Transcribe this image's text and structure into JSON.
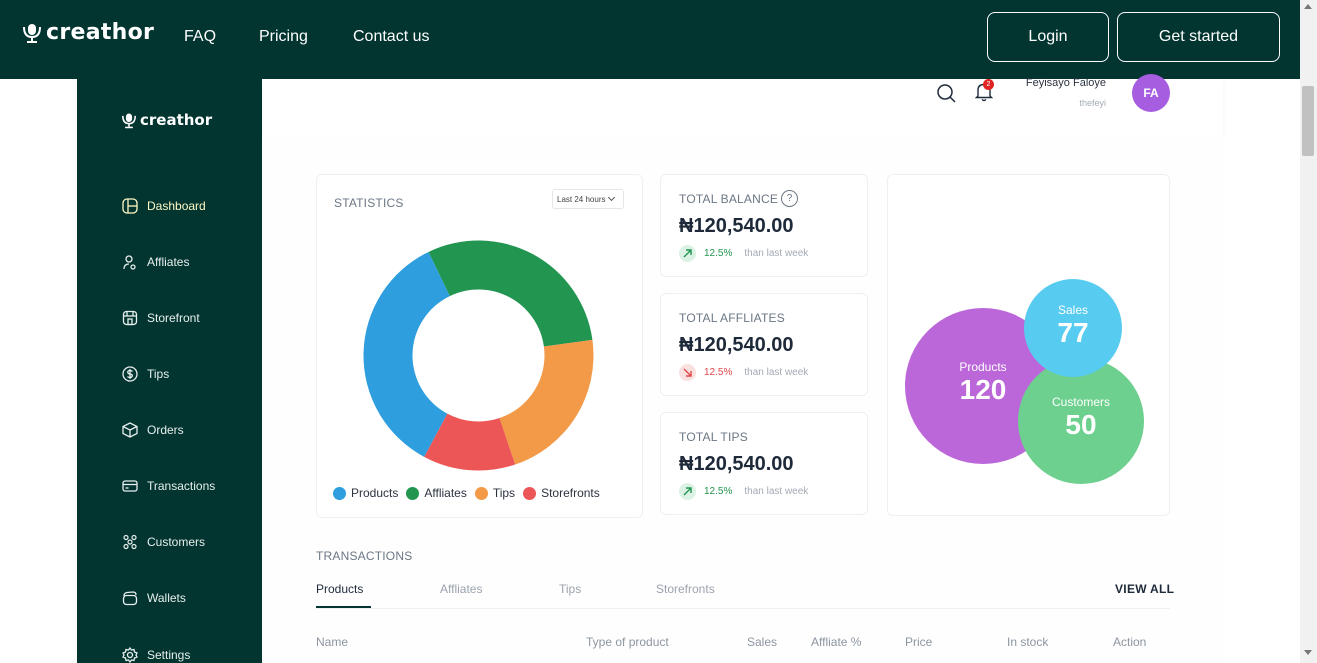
{
  "topnav": {
    "brand": "creathor",
    "links": [
      "FAQ",
      "Pricing",
      "Contact us"
    ],
    "login_label": "Login",
    "get_started_label": "Get started"
  },
  "sidebar": {
    "brand": "creathor",
    "items": [
      {
        "label": "Dashboard",
        "icon": "dashboard-icon",
        "active": true
      },
      {
        "label": "Affliates",
        "icon": "affiliate-user-icon"
      },
      {
        "label": "Storefront",
        "icon": "storefront-icon"
      },
      {
        "label": "Tips",
        "icon": "dollar-coin-icon"
      },
      {
        "label": "Orders",
        "icon": "box-icon"
      },
      {
        "label": "Transactions",
        "icon": "credit-card-icon"
      },
      {
        "label": "Customers",
        "icon": "people-group-icon"
      },
      {
        "label": "Wallets",
        "icon": "wallet-icon"
      },
      {
        "label": "Settings",
        "icon": "gear-icon"
      }
    ]
  },
  "header": {
    "user_name": "Feyisayo Faloye",
    "user_handle": "thefeyi",
    "avatar_initials": "FA",
    "avatar_color": "#a65de0",
    "notification_count": "2"
  },
  "statistics": {
    "title": "STATISTICS",
    "range": "Last 24 hours"
  },
  "chart_data": {
    "type": "pie",
    "donut": true,
    "categories": [
      "Products",
      "Affliates",
      "Tips",
      "Storefronts"
    ],
    "values": [
      35,
      30,
      22,
      13
    ],
    "colors": [
      "#2e9ede",
      "#229551",
      "#f29a48",
      "#ec5656"
    ],
    "legend_placement": "bottom"
  },
  "kpis": [
    {
      "title": "TOTAL BALANCE",
      "value": "₦120,540.00",
      "pct": "12.5%",
      "compare": "than last week",
      "direction": "up",
      "has_help": true
    },
    {
      "title": "TOTAL AFFLIATES",
      "value": "₦120,540.00",
      "pct": "12.5%",
      "compare": "than last week",
      "direction": "down",
      "has_help": false
    },
    {
      "title": "TOTAL TIPS",
      "value": "₦120,540.00",
      "pct": "12.5%",
      "compare": "than last week",
      "direction": "up",
      "has_help": false
    }
  ],
  "bubbles": [
    {
      "label": "Products",
      "value": "120",
      "color": "#bb67d9"
    },
    {
      "label": "Sales",
      "value": "77",
      "color": "#58cbf0"
    },
    {
      "label": "Customers",
      "value": "50",
      "color": "#6ed08f"
    }
  ],
  "transactions": {
    "title": "TRANSACTIONS",
    "tabs": [
      "Products",
      "Affliates",
      "Tips",
      "Storefronts"
    ],
    "view_all": "VIEW ALL",
    "columns": [
      "Name",
      "Type of product",
      "Sales",
      "Affliate %",
      "Price",
      "In stock",
      "Action"
    ]
  }
}
